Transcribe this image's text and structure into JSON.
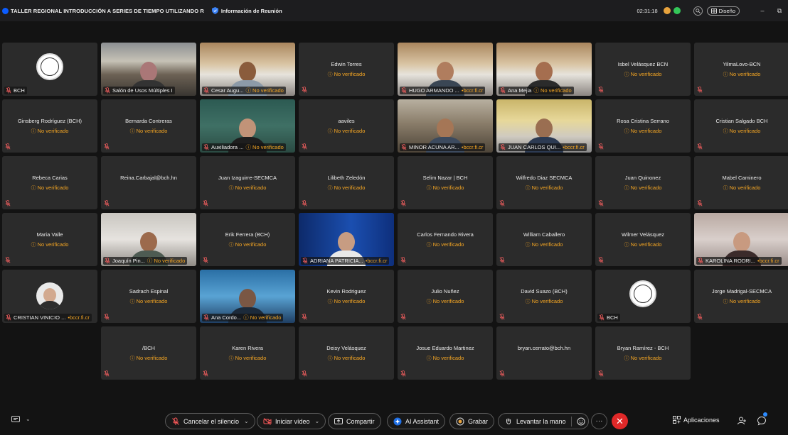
{
  "window": {
    "title": "TALLER REGIONAL INTRODUCCIÓN A SERIES DE TIEMPO UTILIZANDO R",
    "meeting_info": "Información de Reunión",
    "time": "02:31:18",
    "design_label": "Diseño",
    "minimize": "–",
    "restore": "⧉"
  },
  "status_text": "No verificado",
  "tiles": [
    {
      "type": "seal",
      "label": "BCH"
    },
    {
      "type": "video",
      "bg": "v-room",
      "label": "Salón de Usos Múltiples I"
    },
    {
      "type": "video",
      "bg": "v-office",
      "label": "Cesar Augu...",
      "unverified": true,
      "skin": "#8a5c3c",
      "shirt": "#8c9aa8"
    },
    {
      "type": "name",
      "name": "Edwin Torres"
    },
    {
      "type": "video",
      "bg": "v-office",
      "label": "HUGO ARMANDO ...",
      "domain": "bccr.fi.cr",
      "skin": "#b07d5e",
      "shirt": "#3a4654"
    },
    {
      "type": "video",
      "bg": "v-office",
      "label": "Ana Mejia",
      "unverified": true,
      "skin": "#a56e4f",
      "shirt": "#2b2b2b"
    },
    {
      "type": "name",
      "name": "Isbel Velásquez BCN"
    },
    {
      "type": "name",
      "name": "YilmaLovo-BCN"
    },
    {
      "type": "name",
      "name": "Ginsberg Rodríguez (BCH)"
    },
    {
      "type": "name",
      "name": "Bernarda Contreras"
    },
    {
      "type": "video",
      "bg": "v-green",
      "label": "Auxiliadora ...",
      "unverified": true,
      "skin": "#c19378",
      "shirt": "#1e1e1e"
    },
    {
      "type": "name",
      "name": "aaviles"
    },
    {
      "type": "video",
      "bg": "v-room2",
      "label": "MINOR ACUNA AR...",
      "domain": "bccr.fi.cr",
      "skin": "#a57656",
      "shirt": "#3c4a5e"
    },
    {
      "type": "video",
      "bg": "v-yellow",
      "label": "JUAN CARLOS QUI...",
      "domain": "bccr.fi.cr",
      "skin": "#9a6e51",
      "shirt": "#2c3a52"
    },
    {
      "type": "name",
      "name": "Rosa Cristina Serrano"
    },
    {
      "type": "name",
      "name": "Cristian Salgado BCH"
    },
    {
      "type": "name",
      "name": "Rebeca Carias"
    },
    {
      "type": "name",
      "name": "Reina.Carbajal@bch.hn",
      "noverify": true
    },
    {
      "type": "name",
      "name": "Juan Izaguirre-SECMCA"
    },
    {
      "type": "name",
      "name": "Lilibeth Zeledón"
    },
    {
      "type": "name",
      "name": "Selim Nazar | BCH"
    },
    {
      "type": "name",
      "name": "Wilfredo Diaz SECMCA"
    },
    {
      "type": "name",
      "name": "Juan Quinonez"
    },
    {
      "type": "name",
      "name": "Mabel Caminero"
    },
    {
      "type": "name",
      "name": "Maria Valle"
    },
    {
      "type": "video",
      "bg": "v-bank",
      "label": "Joaquín Pin...",
      "unverified": true,
      "skin": "#9c6a4c",
      "shirt": "#4d5b52"
    },
    {
      "type": "name",
      "name": "Erik Ferrera (BCH)"
    },
    {
      "type": "video",
      "bg": "v-blue",
      "label": "ADRIANA PATRICIA...",
      "domain": "bccr.fi.cr",
      "skin": "#c79c82",
      "shirt": "#e8e8e8"
    },
    {
      "type": "name",
      "name": "Carlos Fernando Rivera"
    },
    {
      "type": "name",
      "name": "William Caballero"
    },
    {
      "type": "name",
      "name": "Wilmer Velásquez"
    },
    {
      "type": "video",
      "bg": "v-pink",
      "label": "KAROLINA RODRI...",
      "domain": "bccr.fi.cr",
      "skin": "#c89a80",
      "shirt": "#3b2b2b"
    },
    {
      "type": "avatar",
      "label": "CRISTIAN VINICIO ...",
      "domain": "bccr.fi.cr"
    },
    {
      "type": "name",
      "name": "Sadrach Espinal"
    },
    {
      "type": "video",
      "bg": "v-sky",
      "label": "Ana Cordo...",
      "unverified": true,
      "skin": "#7a5744",
      "shirt": "#1c2a3a"
    },
    {
      "type": "name",
      "name": "Kevin Rodriguez"
    },
    {
      "type": "name",
      "name": "Julio Nuñez"
    },
    {
      "type": "name",
      "name": "David Suazo (BCH)"
    },
    {
      "type": "seal",
      "label": "BCH"
    },
    {
      "type": "name",
      "name": "Jorge Madrigal-SECMCA"
    },
    {
      "type": "empty"
    },
    {
      "type": "name",
      "name": "/BCH"
    },
    {
      "type": "name",
      "name": "Karen Rivera"
    },
    {
      "type": "name",
      "name": "Deisy Velásquez"
    },
    {
      "type": "name",
      "name": "Josue Eduardo Martinez"
    },
    {
      "type": "name",
      "name": "bryan.cerrato@bch.hn",
      "noverify": true
    },
    {
      "type": "name",
      "name": "Bryan Ramírez - BCH"
    }
  ],
  "toolbar": {
    "mute": "Cancelar el silencio",
    "video": "Iniciar vídeo",
    "share": "Compartir",
    "ai": "AI Assistant",
    "record": "Grabar",
    "raise_hand": "Levantar la mano",
    "more": "···",
    "apps": "Aplicaciones"
  },
  "colors": {
    "accent": "#0b5cff",
    "warning": "#f5a623",
    "end_call": "#e02828",
    "tile_bg": "#2b2b2b"
  }
}
